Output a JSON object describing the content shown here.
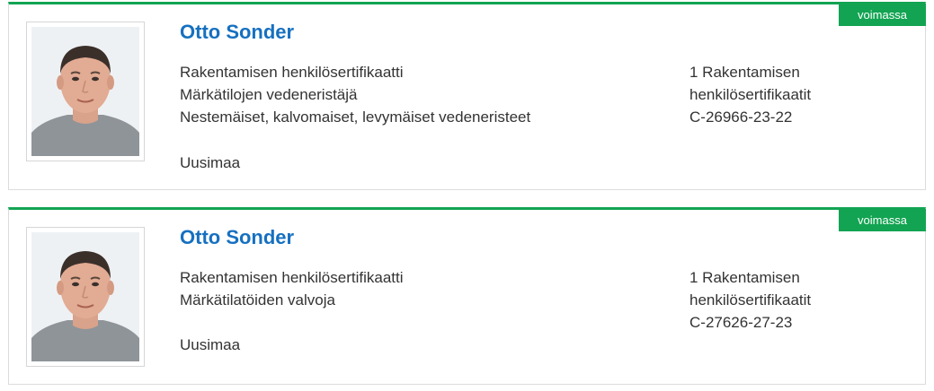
{
  "colors": {
    "accent": "#12a452",
    "name_link": "#1670c0",
    "text": "#333333"
  },
  "results": [
    {
      "status": "voimassa",
      "name": "Otto Sonder",
      "qualification_lines": [
        "Rakentamisen henkilösertifikaatti",
        "Märkätilojen vedeneristäjä",
        "Nestemäiset, kalvomaiset, levymäiset vedeneristeet"
      ],
      "region": "Uusimaa",
      "certificate_lines": [
        "1 Rakentamisen",
        "henkilösertifikaatit",
        "C-26966-23-22"
      ],
      "photo": "person-portrait"
    },
    {
      "status": "voimassa",
      "name": "Otto Sonder",
      "qualification_lines": [
        "Rakentamisen henkilösertifikaatti",
        "Märkätilatöiden valvoja"
      ],
      "region": "Uusimaa",
      "certificate_lines": [
        "1 Rakentamisen",
        "henkilösertifikaatit",
        "C-27626-27-23"
      ],
      "photo": "person-portrait"
    }
  ]
}
